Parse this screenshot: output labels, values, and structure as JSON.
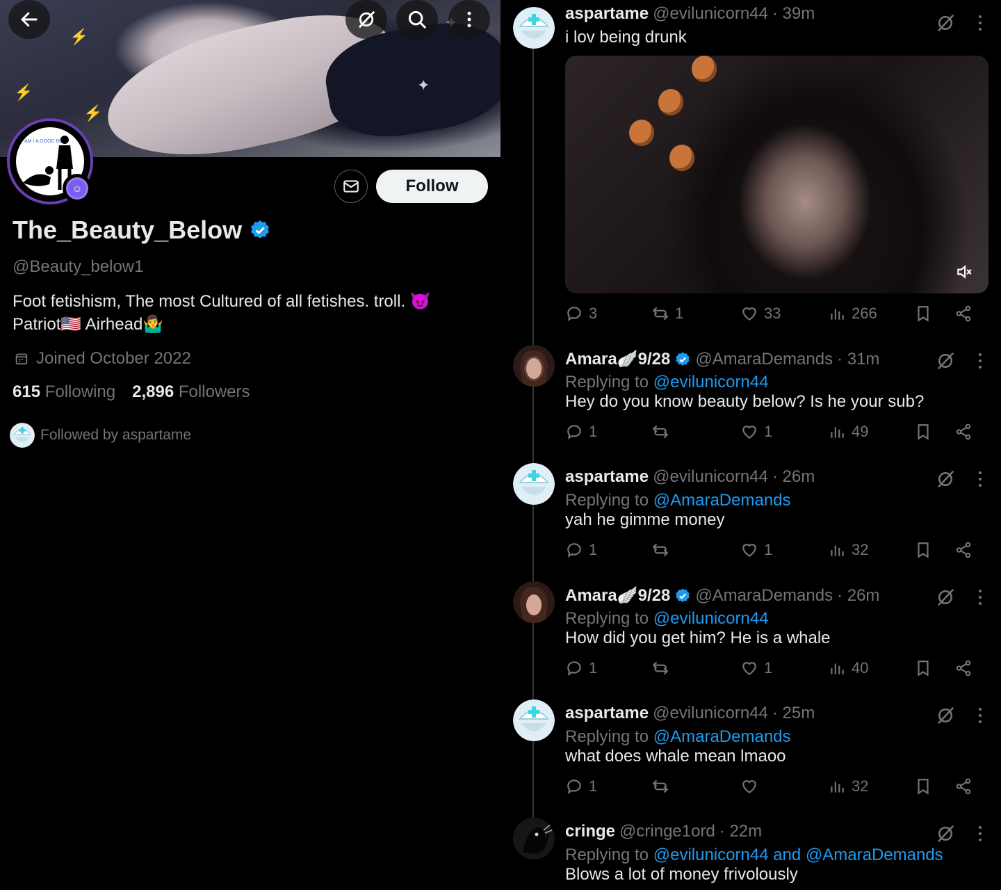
{
  "profile": {
    "display_name": "The_Beauty_Below",
    "handle": "@Beauty_below1",
    "bio_line1": "Foot fetishism, The most Cultured of all fetishes. troll. 😈",
    "bio_line2": "Patriot🇺🇸 Airhead🤷‍♂️",
    "joined": "Joined October 2022",
    "following_count": "615",
    "following_label": "Following",
    "followers_count": "2,896",
    "followers_label": "Followers",
    "followed_by": "Followed by aspartame",
    "follow_label": "Follow",
    "avatar_text": "AM I A GOOD BOY"
  },
  "colors": {
    "accent": "#1d9bf0",
    "muted": "#71767b",
    "avatar_ring": "#6a3fb0",
    "badge": "#7b5cf0"
  },
  "tweets": [
    {
      "name": "aspartame",
      "handle": "@evilunicorn44",
      "time": "· 39m",
      "replying_prefix": "",
      "replying_to": "",
      "text": "i lov being drunk",
      "replies": "3",
      "reposts": "1",
      "likes": "33",
      "views": "266"
    },
    {
      "name": "Amara🪽9/28",
      "handle": "@AmaraDemands",
      "time": "· 31m",
      "replying_prefix": "Replying to",
      "replying_to": "@evilunicorn44",
      "text": "Hey do you know beauty below? Is he your sub?",
      "replies": "1",
      "reposts": "",
      "likes": "1",
      "views": "49"
    },
    {
      "name": "aspartame",
      "handle": "@evilunicorn44",
      "time": "· 26m",
      "replying_prefix": "Replying to",
      "replying_to": "@AmaraDemands",
      "text": "yah he gimme money",
      "replies": "1",
      "reposts": "",
      "likes": "1",
      "views": "32"
    },
    {
      "name": "Amara🪽9/28",
      "handle": "@AmaraDemands",
      "time": "· 26m",
      "replying_prefix": "Replying to",
      "replying_to": "@evilunicorn44",
      "text": "How did you get him? He is a whale",
      "replies": "1",
      "reposts": "",
      "likes": "1",
      "views": "40"
    },
    {
      "name": "aspartame",
      "handle": "@evilunicorn44",
      "time": "· 25m",
      "replying_prefix": "Replying to",
      "replying_to": "@AmaraDemands",
      "text": "what does whale mean lmaoo",
      "replies": "1",
      "reposts": "",
      "likes": "",
      "views": "32"
    },
    {
      "name": "cringe",
      "handle": "@cringe1ord",
      "time": "· 22m",
      "replying_prefix": "Replying to",
      "replying_to": "@evilunicorn44 and @AmaraDemands",
      "text": "Blows a lot of money frivolously",
      "replies": "",
      "reposts": "",
      "likes": "",
      "views": ""
    }
  ]
}
